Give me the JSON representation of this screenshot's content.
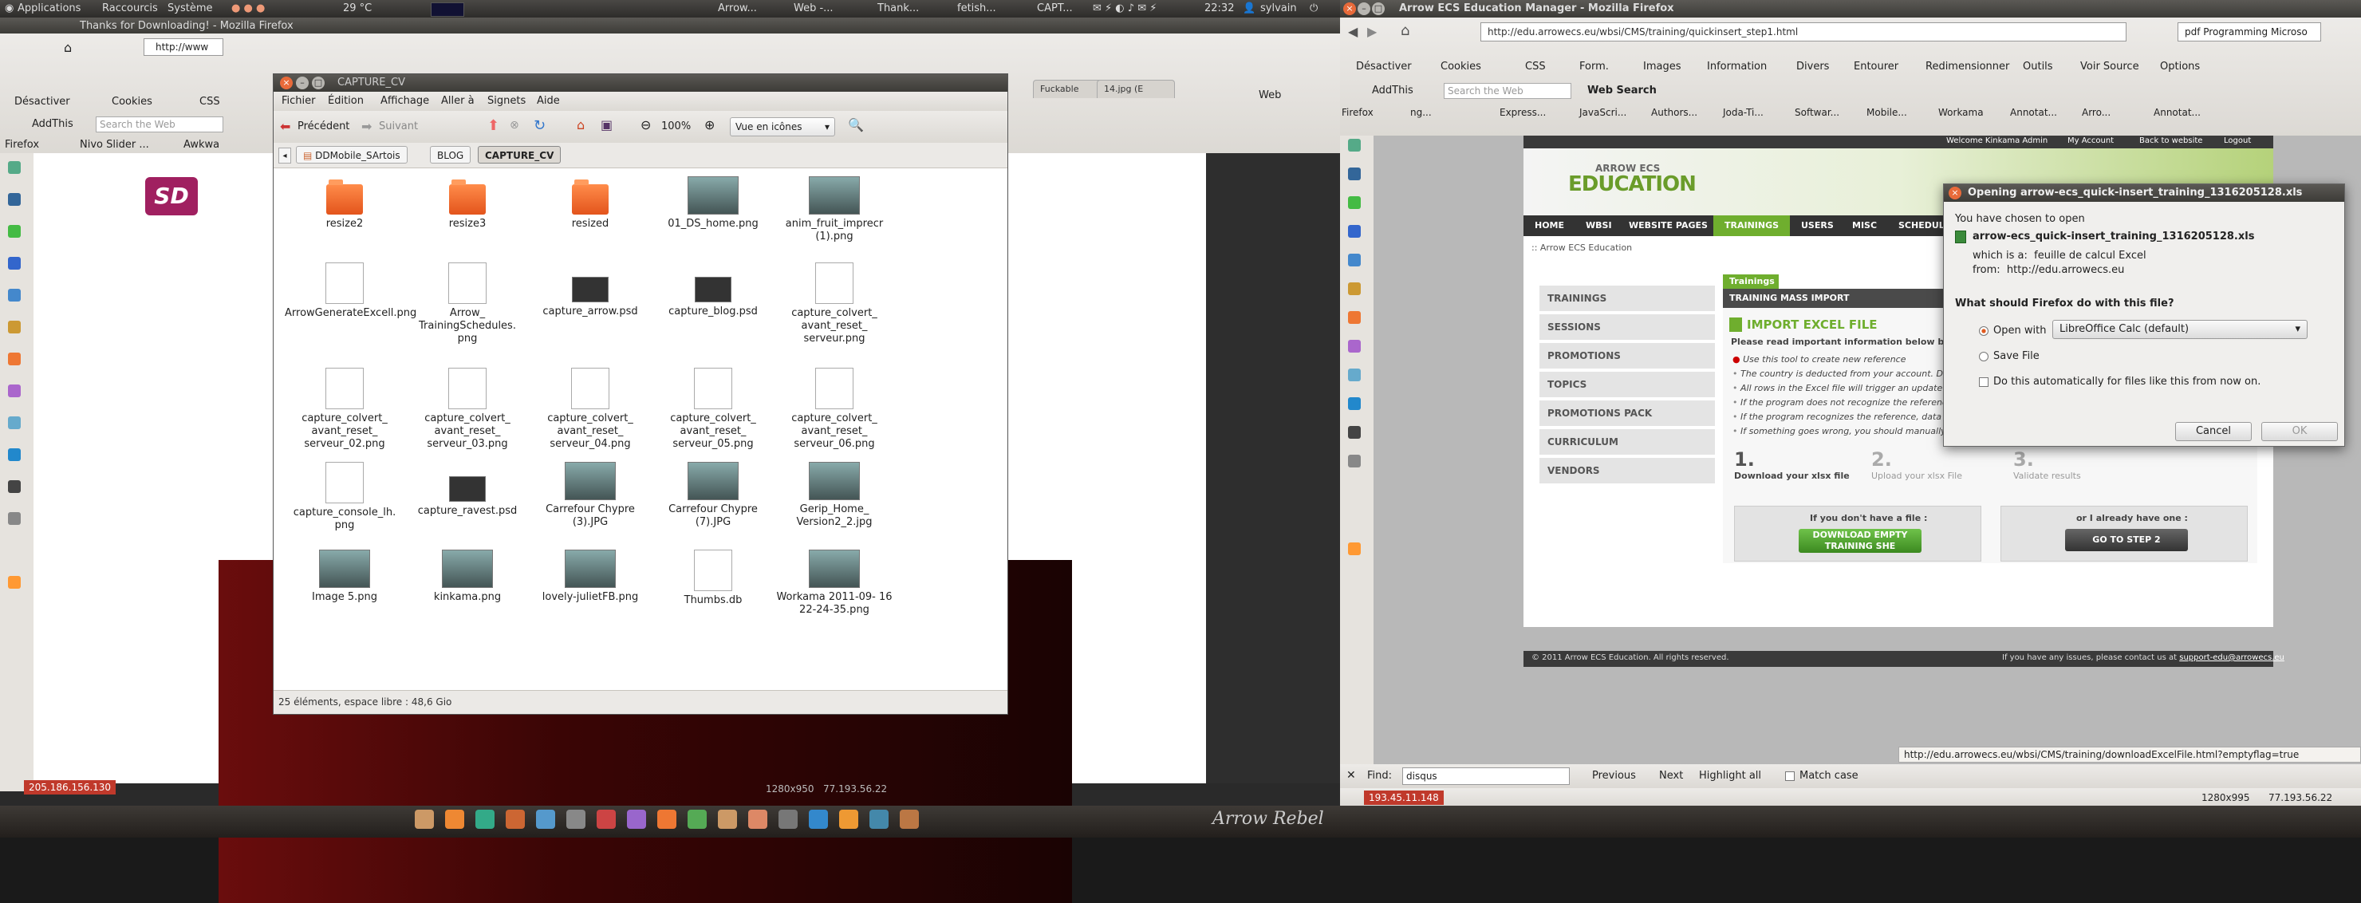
{
  "top_panel": {
    "menus": [
      "Applications",
      "Raccourcis",
      "Système"
    ],
    "weather": "29 °C",
    "taskbar": [
      "Arrow...",
      "Web -...",
      "Thank...",
      "fetish...",
      "CAPT..."
    ],
    "clock": "22:32",
    "user": "sylvain"
  },
  "left_browser": {
    "window_title": "Thanks for Downloading! - Mozilla Firefox",
    "url": "http://www",
    "toolbar_items": [
      "Désactiver",
      "Cookies",
      "CSS"
    ],
    "addthis": "AddThis",
    "search_placeholder": "Search the Web",
    "bookmarks": [
      "Firefox",
      "Nivo Slider ...",
      "Awkwa"
    ],
    "tabs": [
      "Fuckable",
      "14.jpg (E"
    ],
    "web_label": "Web",
    "site_logo": "SD",
    "status_ip": "205.186.156.130"
  },
  "file_manager": {
    "window_title": "CAPTURE_CV",
    "menu": [
      "Fichier",
      "Édition",
      "Affichage",
      "Aller à",
      "Signets",
      "Aide"
    ],
    "back_label": "Précédent",
    "forward_label": "Suivant",
    "zoom": "100%",
    "view_mode": "Vue en icônes",
    "breadcrumbs": [
      "DDMobile_SArtois",
      "BLOG",
      "CAPTURE_CV"
    ],
    "files": [
      {
        "name": "resize2",
        "kind": "folder"
      },
      {
        "name": "resize3",
        "kind": "folder"
      },
      {
        "name": "resized",
        "kind": "folder"
      },
      {
        "name": "01_DS_home.png",
        "kind": "image"
      },
      {
        "name": "anim_fruit_imprecr (1).png",
        "kind": "image"
      },
      {
        "name": "ArrowGenerateExcell.png",
        "kind": "doc"
      },
      {
        "name": "Arrow_ TrainingSchedules. png",
        "kind": "doc"
      },
      {
        "name": "capture_arrow.psd",
        "kind": "dark"
      },
      {
        "name": "capture_blog.psd",
        "kind": "dark"
      },
      {
        "name": "capture_colvert_ avant_reset_ serveur.png",
        "kind": "doc"
      },
      {
        "name": "capture_colvert_ avant_reset_ serveur_02.png",
        "kind": "doc"
      },
      {
        "name": "capture_colvert_ avant_reset_ serveur_03.png",
        "kind": "doc"
      },
      {
        "name": "capture_colvert_ avant_reset_ serveur_04.png",
        "kind": "doc"
      },
      {
        "name": "capture_colvert_ avant_reset_ serveur_05.png",
        "kind": "doc"
      },
      {
        "name": "capture_colvert_ avant_reset_ serveur_06.png",
        "kind": "doc"
      },
      {
        "name": "capture_console_lh. png",
        "kind": "doc"
      },
      {
        "name": "capture_ravest.psd",
        "kind": "dark"
      },
      {
        "name": "Carrefour Chypre (3).JPG",
        "kind": "image"
      },
      {
        "name": "Carrefour Chypre (7).JPG",
        "kind": "image"
      },
      {
        "name": "Gerip_Home_ Version2_2.jpg",
        "kind": "image"
      },
      {
        "name": "Image 5.png",
        "kind": "image"
      },
      {
        "name": "kinkama.png",
        "kind": "image"
      },
      {
        "name": "lovely-julietFB.png",
        "kind": "image"
      },
      {
        "name": "Thumbs.db",
        "kind": "doc"
      },
      {
        "name": "Workama 2011-09- 16 22-24-35.png",
        "kind": "image"
      }
    ],
    "status": "25 éléments, espace libre : 48,6 Gio"
  },
  "right_browser": {
    "window_title": "Arrow ECS Education Manager - Mozilla Firefox",
    "url": "http://edu.arrowecs.eu/wbsi/CMS/training/quickinsert_step1.html",
    "search_box": "pdf Programming Microso",
    "toolbar_items": [
      "Désactiver",
      "Cookies",
      "CSS",
      "Form.",
      "Images",
      "Information",
      "Divers",
      "Entourer",
      "Redimensionner",
      "Outils",
      "Voir Source",
      "Options"
    ],
    "addthis": "AddThis",
    "search_placeholder": "Search the Web",
    "web_search": "Web Search",
    "tabs": [
      "Firefox",
      "ng...",
      "Express...",
      "JavaScri...",
      "Authors...",
      "Joda-Ti...",
      "Softwar...",
      "Mobile...",
      "Workama",
      "Annotat...",
      "Arro...",
      "Annotat..."
    ],
    "status_url": "http://edu.arrowecs.eu/wbsi/CMS/training/downloadExcelFile.html?emptyflag=true",
    "find_label": "Find:",
    "find_value": "disqus",
    "find_previous": "Previous",
    "find_next": "Next",
    "find_highlight": "Highlight all",
    "find_match_case": "Match case",
    "status_ip": "193.45.11.148",
    "resolution": "1280x995",
    "remote_ip": "77.193.56.22"
  },
  "site": {
    "top_links": [
      "Welcome Kinkama Admin",
      "My Account",
      "Back to website",
      "Logout"
    ],
    "logo_small": "ARROW ECS",
    "logo_big": "EDUCATION",
    "nav": [
      "HOME",
      "WBSI",
      "WEBSITE PAGES",
      "TRAININGS",
      "USERS",
      "MISC",
      "SCHEDUL"
    ],
    "breadcrumb": ":: Arrow ECS Education",
    "sidebar": [
      "TRAININGS",
      "SESSIONS",
      "PROMOTIONS",
      "TOPICS",
      "PROMOTIONS PACK",
      "CURRICULUM",
      "VENDORS"
    ],
    "section_tab": "Trainings",
    "section_title": "TRAINING MASS IMPORT",
    "import_title": "IMPORT EXCEL FILE",
    "import_note": "Please read important information below before submitt",
    "bullets": [
      "Use this tool to create new reference",
      "The country is deducted from your account. Do not us",
      "All rows in the Excel file will trigger an update (or creat",
      "If the program does not recognize the reference, a ne",
      "If the program recognizes the reference, data will not",
      "If something goes wrong, you should manually edit so"
    ],
    "steps": [
      {
        "num": "1.",
        "label": "Download your xlsx file"
      },
      {
        "num": "2.",
        "label": "Upload your xlsx File"
      },
      {
        "num": "3.",
        "label": "Validate results"
      }
    ],
    "no_file_label": "If you don't have a file :",
    "download_button": "DOWNLOAD EMPTY TRAINING SHE",
    "have_file_label": "or I already have one :",
    "step2_button": "GO TO STEP 2",
    "footer_left": "© 2011 Arrow ECS Education. All rights reserved.",
    "footer_right_prefix": "If you have any issues, please contact us at",
    "footer_email": "support-edu@arrowecs.eu"
  },
  "dialog": {
    "title": "Opening arrow-ecs_quick-insert_training_1316205128.xls",
    "intro": "You have chosen to open",
    "filename": "arrow-ecs_quick-insert_training_1316205128.xls",
    "which_is": "which is a:  feuille de calcul Excel",
    "from": "from:  http://edu.arrowecs.eu",
    "question": "What should Firefox do with this file?",
    "open_with_label": "Open with",
    "open_with_value": "LibreOffice Calc (default)",
    "save_label": "Save File",
    "auto_label": "Do this automatically for files like this from now on.",
    "cancel": "Cancel",
    "ok": "OK"
  },
  "bottom": {
    "left_info": "1280x950",
    "left_ip": "77.193.56.22",
    "wallpaper_text": "Arrow Rebel"
  }
}
